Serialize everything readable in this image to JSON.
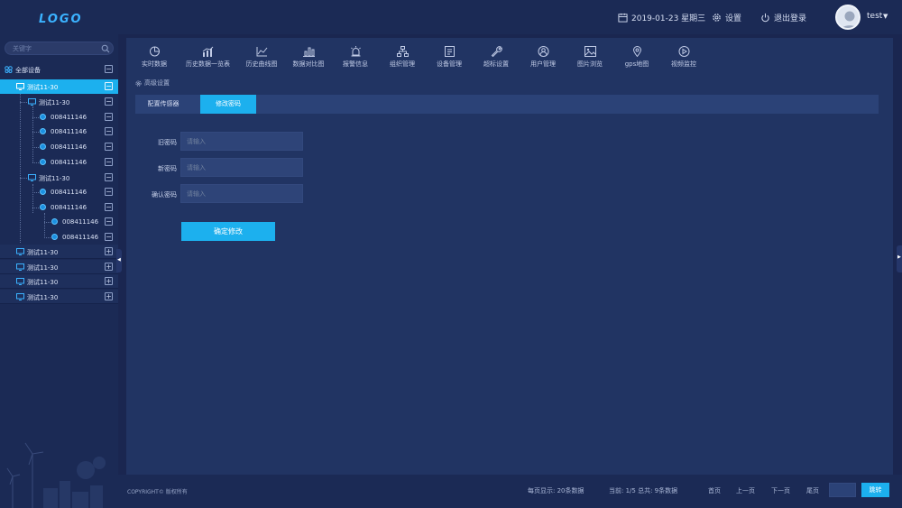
{
  "header": {
    "logo": "LOGO",
    "date": "2019-01-23 星期三",
    "settings_label": "设置",
    "logout_label": "退出登录",
    "username": "test"
  },
  "sidebar": {
    "search_placeholder": "关键字",
    "root_label": "全部设备",
    "rows": [
      {
        "label": "测试11-30",
        "toggle": "−"
      },
      {
        "label": "测试11-30",
        "toggle": "−"
      },
      {
        "label": "008411146",
        "toggle": "−"
      },
      {
        "label": "008411146",
        "toggle": "−"
      },
      {
        "label": "008411146",
        "toggle": "−"
      },
      {
        "label": "008411146",
        "toggle": "−"
      },
      {
        "label": "测试11-30",
        "toggle": "−"
      },
      {
        "label": "008411146",
        "toggle": "−"
      },
      {
        "label": "008411146",
        "toggle": "−"
      },
      {
        "label": "008411146",
        "toggle": "−"
      },
      {
        "label": "008411146",
        "toggle": "−"
      },
      {
        "label": "测试11-30",
        "toggle": "+"
      },
      {
        "label": "测试11-30",
        "toggle": "+"
      },
      {
        "label": "测试11-30",
        "toggle": "+"
      },
      {
        "label": "测试11-30",
        "toggle": "+"
      }
    ]
  },
  "nav": {
    "items": [
      {
        "label": "实时数据",
        "icon": "pie-chart-icon"
      },
      {
        "label": "历史数据一览表",
        "icon": "bar-line-chart-icon"
      },
      {
        "label": "历史曲线图",
        "icon": "line-chart-icon"
      },
      {
        "label": "数据对比图",
        "icon": "bar-chart-icon"
      },
      {
        "label": "报警信息",
        "icon": "alarm-icon"
      },
      {
        "label": "组织管理",
        "icon": "org-tree-icon"
      },
      {
        "label": "设备管理",
        "icon": "device-list-icon"
      },
      {
        "label": "超标设置",
        "icon": "wrench-icon"
      },
      {
        "label": "用户管理",
        "icon": "user-icon"
      },
      {
        "label": "图片浏览",
        "icon": "image-icon"
      },
      {
        "label": "gps地图",
        "icon": "location-pin-icon"
      },
      {
        "label": "视频监控",
        "icon": "play-icon"
      }
    ]
  },
  "breadcrumb": "高级设置",
  "tabs": [
    {
      "label": "配置传感器"
    },
    {
      "label": "修改密码"
    }
  ],
  "form": {
    "old_password_label": "旧密码",
    "new_password_label": "新密码",
    "confirm_password_label": "确认密码",
    "placeholder": "请输入",
    "submit_label": "确定修改"
  },
  "footer": {
    "copyright": "COPYRIGHT© 版权所有",
    "per_page": "每页显示:  20条数据",
    "current": "当前:  1/5  总共:  9条数据",
    "first": "首页",
    "prev": "上一页",
    "next": "下一页",
    "last": "尾页",
    "go": "跳转"
  },
  "colors": {
    "accent": "#1cb0ee",
    "background": "#1a2650",
    "panel": "#213463"
  }
}
